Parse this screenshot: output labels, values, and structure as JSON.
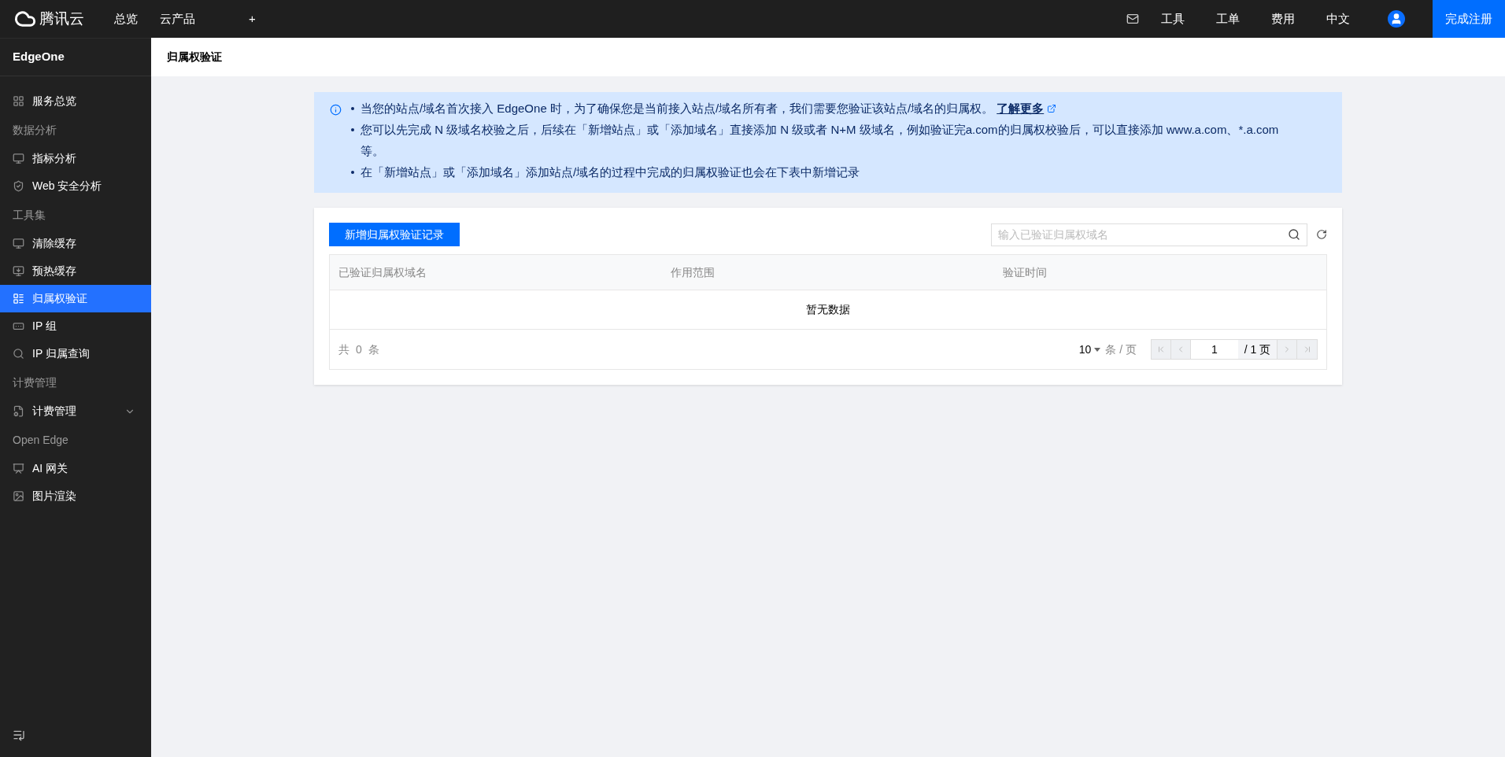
{
  "topbar": {
    "logo_text": "腾讯云",
    "nav": [
      "总览",
      "云产品",
      "+"
    ],
    "right_items": [
      "工具",
      "工单",
      "费用",
      "中文"
    ],
    "register_button": "完成注册"
  },
  "sidebar": {
    "title": "EdgeOne",
    "items": [
      {
        "kind": "item",
        "label": "服务总览",
        "selected": false
      },
      {
        "kind": "group",
        "label": "数据分析"
      },
      {
        "kind": "item",
        "label": "指标分析",
        "selected": false
      },
      {
        "kind": "item",
        "label": "Web 安全分析",
        "selected": false
      },
      {
        "kind": "group",
        "label": "工具集"
      },
      {
        "kind": "item",
        "label": "清除缓存",
        "selected": false
      },
      {
        "kind": "item",
        "label": "预热缓存",
        "selected": false
      },
      {
        "kind": "item",
        "label": "归属权验证",
        "selected": true
      },
      {
        "kind": "item",
        "label": "IP 组",
        "selected": false
      },
      {
        "kind": "item",
        "label": "IP 归属查询",
        "selected": false
      },
      {
        "kind": "group",
        "label": "计费管理"
      },
      {
        "kind": "submenu",
        "label": "计费管理",
        "selected": false,
        "expanded": false
      },
      {
        "kind": "group",
        "label": "Open Edge"
      },
      {
        "kind": "item",
        "label": "AI 网关",
        "selected": false
      },
      {
        "kind": "item",
        "label": "图片渲染",
        "selected": false
      }
    ]
  },
  "page_title": "归属权验证",
  "notice": [
    {
      "text": "当您的站点/域名首次接入 EdgeOne 时，为了确保您是当前接入站点/域名所有者，我们需要您验证该站点/域名的归属权。",
      "link": "了解更多"
    },
    {
      "text": "您可以先完成 N 级域名校验之后，后续在「新增站点」或「添加域名」直接添加 N 级或者 N+M 级域名，例如验证完a.com的归属权校验后，可以直接添加 www.a.com、*.a.com 等。"
    },
    {
      "text": "在「新增站点」或「添加域名」添加站点/域名的过程中完成的归属权验证也会在下表中新增记录"
    }
  ],
  "add_button": "新增归属权验证记录",
  "search": {
    "placeholder": "输入已验证归属权域名"
  },
  "table": {
    "columns": [
      "已验证归属权域名",
      "作用范围",
      "验证时间"
    ],
    "empty_text": "暂无数据"
  },
  "pagination": {
    "total": "共 0 条",
    "page_size": "10",
    "page_size_unit": "条 / 页",
    "page": "1",
    "page_count": "/ 1 页"
  }
}
